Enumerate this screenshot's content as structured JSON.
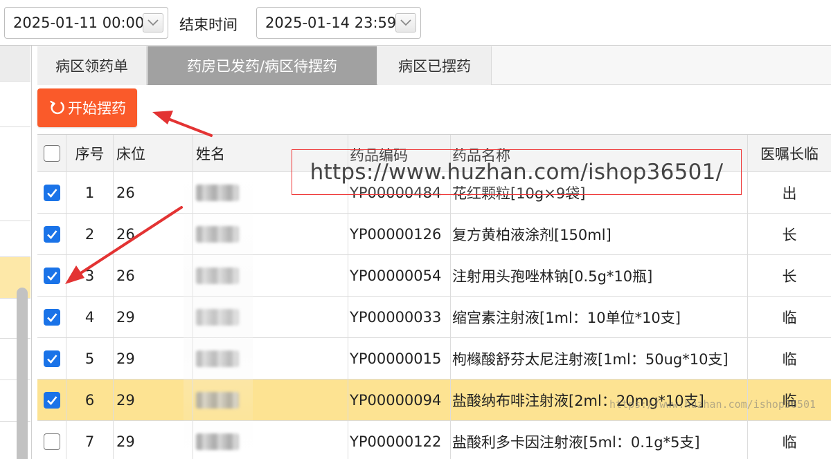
{
  "filters": {
    "start_date": "2025-01-11 00:00",
    "end_label": "结束时间",
    "end_date": "2025-01-14 23:59"
  },
  "tabs": [
    {
      "label": "病区领药单",
      "active": false
    },
    {
      "label": "药房已发药/病区待摆药",
      "active": true
    },
    {
      "label": "病区已摆药",
      "active": false
    }
  ],
  "start_button": {
    "label": "开始摆药",
    "icon": "refresh-icon",
    "color": "#fa5a2a"
  },
  "table": {
    "columns": [
      "序号",
      "床位",
      "姓名",
      "药品编码",
      "药品名称",
      "医嘱长临"
    ],
    "rows": [
      {
        "seq": "1",
        "bed": "26",
        "name": "",
        "code": "YP00000484",
        "drug": "花红颗粒[10g×9袋]",
        "type": "出",
        "checked": true,
        "selected": false
      },
      {
        "seq": "2",
        "bed": "26",
        "name": "",
        "code": "YP00000126",
        "drug": "复方黄柏液涂剂[150ml]",
        "type": "长",
        "checked": true,
        "selected": false
      },
      {
        "seq": "3",
        "bed": "26",
        "name": "",
        "code": "YP00000054",
        "drug": "注射用头孢唑林钠[0.5g*10瓶]",
        "type": "长",
        "checked": true,
        "selected": false
      },
      {
        "seq": "4",
        "bed": "29",
        "name": "",
        "code": "YP00000033",
        "drug": "缩宫素注射液[1ml：10单位*10支]",
        "type": "临",
        "checked": true,
        "selected": false
      },
      {
        "seq": "5",
        "bed": "29",
        "name": "",
        "code": "YP00000015",
        "drug": "枸橼酸舒芬太尼注射液[1ml：50ug*10支]",
        "type": "临",
        "checked": true,
        "selected": false
      },
      {
        "seq": "6",
        "bed": "29",
        "name": "",
        "code": "YP00000094",
        "drug": "盐酸纳布啡注射液[2ml：20mg*10支]",
        "type": "临",
        "checked": true,
        "selected": true
      },
      {
        "seq": "7",
        "bed": "29",
        "name": "",
        "code": "YP00000122",
        "drug": "盐酸利多卡因注射液[5ml：0.1g*5支]",
        "type": "临",
        "checked": false,
        "selected": false
      }
    ]
  },
  "watermark": {
    "url": "https://www.huzhan.com/ishop36501/",
    "small": "https://www.huzhan.com/ishop36501"
  },
  "colors": {
    "accent": "#fa5a2a",
    "checkbox": "#1a73e8",
    "selected_row": "#fde392",
    "annotation": "#e33333"
  }
}
